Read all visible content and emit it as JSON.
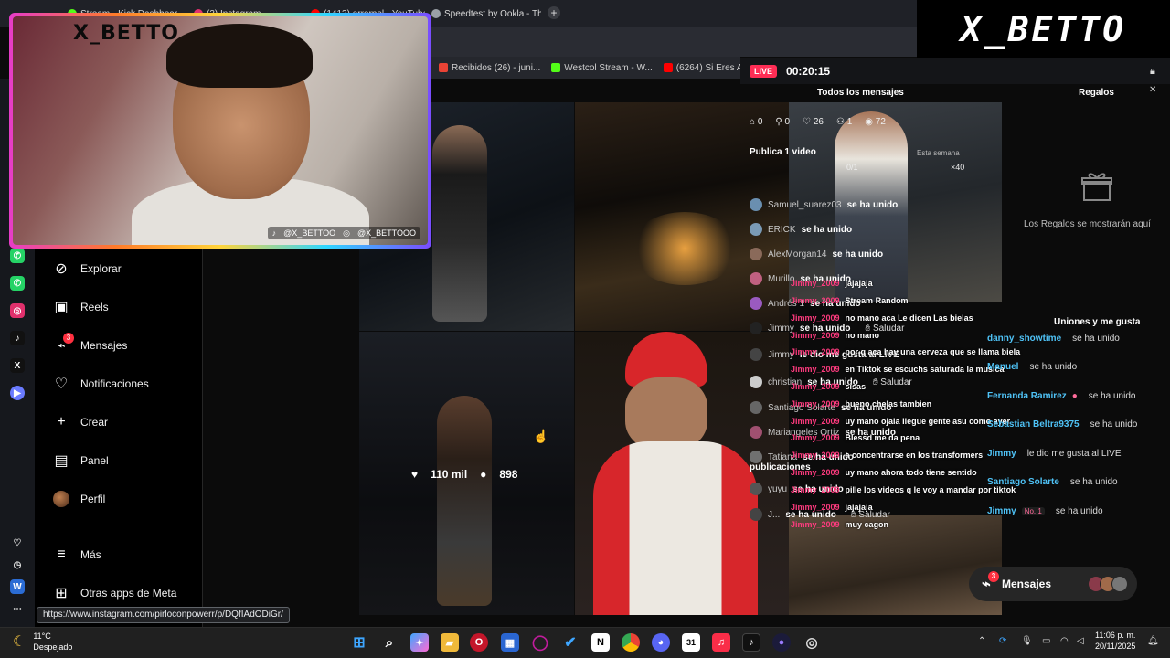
{
  "browser": {
    "tabs": [
      {
        "label": "Stream - Kick Dashboard",
        "color": "#53fc18"
      },
      {
        "label": "(3) Instagram",
        "color": "#e1306c"
      },
      {
        "label": "(1413) errorpel - YouTube",
        "color": "#ff0000"
      },
      {
        "label": "Speedtest by Ookla - The",
        "color": "#9aa0a6"
      }
    ],
    "new_tab_icon": "plus-icon",
    "bookmarks": [
      {
        "label": "Recibidos (26) - juni...",
        "color": "#ea4335"
      },
      {
        "label": "Westcol Stream - W...",
        "color": "#53fc18"
      },
      {
        "label": "(6264) Si Eres Ambi...",
        "color": "#ff0000"
      }
    ]
  },
  "webcam": {
    "title": "X_BETTO",
    "tag_tiktok": "@X_BETTOO",
    "tag_instagram": "@X_BETTOOO"
  },
  "brand_logo": "X_BETTO",
  "sidebar": {
    "items": [
      {
        "label": "Explorar",
        "icon": "compass-icon"
      },
      {
        "label": "Reels",
        "icon": "reels-icon"
      },
      {
        "label": "Mensajes",
        "icon": "messenger-icon",
        "badge": "3"
      },
      {
        "label": "Notificaciones",
        "icon": "heart-icon"
      },
      {
        "label": "Crear",
        "icon": "plus-icon"
      },
      {
        "label": "Panel",
        "icon": "chart-icon"
      },
      {
        "label": "Perfil",
        "icon": "avatar"
      }
    ],
    "more": "Más",
    "meta_apps": "Otras apps de Meta"
  },
  "post_hover": {
    "likes": "110 mil",
    "comments": "898"
  },
  "live": {
    "badge": "LIVE",
    "timer": "00:20:15",
    "tab_all": "Todos los mensajes",
    "tab_gifts": "Regalos",
    "stats": {
      "gifts": "0",
      "followers": "0",
      "likes": "26",
      "viewers_now": "1",
      "views": "72"
    },
    "publish_goal": "Publica 1 video",
    "this_week": "Esta semana",
    "progress": "0/1",
    "multiplier": "×40",
    "gifts_empty": "Los Regalos se mostrarán aquí",
    "joins": [
      {
        "name": "Samuel_suarez03",
        "text": "se ha unido",
        "color": "#6a8fb0"
      },
      {
        "name": "ERICK",
        "text": "se ha unido",
        "color": "#7a9ab5"
      },
      {
        "name": "AlexMorgan14",
        "text": "se ha unido",
        "color": "#8a6a5a"
      },
      {
        "name": "Murillo",
        "text": "se ha unido",
        "color": "#c06080"
      },
      {
        "name": "Andrés 1",
        "text": "se ha unido",
        "color": "#9a5ac0"
      },
      {
        "name": "Jimmy",
        "text": "se ha unido",
        "color": "#222",
        "action": "Saludar"
      },
      {
        "name": "Jimmy",
        "text": "le dio me gusta al LIVE",
        "color": "#444"
      },
      {
        "name": "christian",
        "text": "se ha unido",
        "color": "#ccc",
        "action": "Saludar"
      },
      {
        "name": "Santiago Solarte",
        "text": "se ha unido",
        "color": "#666"
      },
      {
        "name": "Mariangeles Ortiz",
        "text": "se ha unido",
        "color": "#a05070"
      },
      {
        "name": "Tatiana",
        "text": "se ha unido",
        "color": "#707070"
      },
      {
        "name": "yuyu",
        "text": "se ha unido",
        "color": "#555"
      },
      {
        "name": "J...",
        "text": "se ha unido",
        "color": "#444",
        "action": "Saludar"
      }
    ],
    "chat": [
      {
        "user": "Jimmy_2009",
        "msg": "jajajaja"
      },
      {
        "user": "Jimmy_2009",
        "msg": "Stream Random"
      },
      {
        "user": "Jimmy_2009",
        "msg": "no mano aca Le dicen Las bielas"
      },
      {
        "user": "Jimmy_2009",
        "msg": "no mano"
      },
      {
        "user": "Jimmy_2009",
        "msg": "por q aca hay una cerveza que se llama biela"
      },
      {
        "user": "Jimmy_2009",
        "msg": "en Tiktok se escuchs saturada la musica"
      },
      {
        "user": "Jimmy_2009",
        "msg": "sisas"
      },
      {
        "user": "Jimmy_2009",
        "msg": "bueno chelas tambien"
      },
      {
        "user": "Jimmy_2009",
        "msg": "uy mano ojala llegue gente asu como ayer"
      },
      {
        "user": "Jimmy_2009",
        "msg": "Blessd me da pena"
      },
      {
        "user": "Jimmy_2009",
        "msg": "a concentrarse en los transformers"
      },
      {
        "user": "Jimmy_2009",
        "msg": "uy mano ahora todo tiene sentido"
      },
      {
        "user": "Jimmy_2009",
        "msg": "pille los videos q le voy a mandar por tiktok"
      },
      {
        "user": "Jimmy_2009",
        "msg": "jajajaja"
      },
      {
        "user": "Jimmy_2009",
        "msg": "muy cagon"
      }
    ],
    "publications": "publicaciones",
    "uniones_title": "Uniones y me gusta",
    "uniones": [
      {
        "name": "danny_showtime",
        "text": "se ha unido"
      },
      {
        "name": "Manuel",
        "text": "se ha unido"
      },
      {
        "name": "Fernanda Ramirez",
        "text": "se ha unido"
      },
      {
        "name": "Sebastian Beltra9375",
        "text": "se ha unido"
      },
      {
        "name": "Jimmy",
        "text": "le dio me gusta al LIVE"
      },
      {
        "name": "Santiago Solarte",
        "text": "se ha unido"
      },
      {
        "name": "Jimmy",
        "text": "se ha unido",
        "level": "No. 1"
      }
    ]
  },
  "messages_button": {
    "label": "Mensajes",
    "badge": "3"
  },
  "status_url": "https://www.instagram.com/pirloconpowerr/p/DQfIAdODiGr/",
  "taskbar": {
    "weather_temp": "11°C",
    "weather_desc": "Despejado",
    "time": "11:06 p. m.",
    "date": "20/11/2025"
  }
}
